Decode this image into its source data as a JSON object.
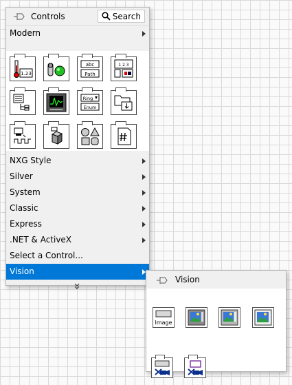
{
  "palette": {
    "title": "Controls",
    "search_label": "Search",
    "top_category": "Modern",
    "categories": [
      {
        "label": "NXG Style"
      },
      {
        "label": "Silver"
      },
      {
        "label": "System"
      },
      {
        "label": "Classic"
      },
      {
        "label": "Express"
      },
      {
        "label": ".NET & ActiveX"
      }
    ],
    "select_control": "Select a Control...",
    "selected_category": "Vision",
    "tiles": {
      "numeric": "1.23",
      "string_abc": "abc",
      "string_path": "Path",
      "array_digits": "1 2 3",
      "ring": "Ring",
      "enum": "Enum"
    }
  },
  "submenu": {
    "title": "Vision",
    "image_label": "Image"
  },
  "colors": {
    "accent": "#0078d7",
    "led_green": "#22c022"
  }
}
